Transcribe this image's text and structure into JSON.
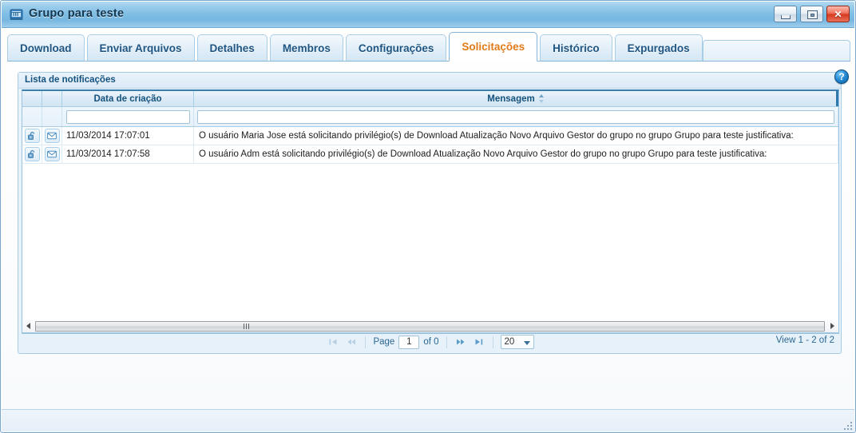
{
  "window": {
    "title": "Grupo para teste",
    "icon": "window-app-icon",
    "controls": [
      {
        "name": "minimize-button",
        "glyph": "minimize"
      },
      {
        "name": "maximize-button",
        "glyph": "maximize"
      },
      {
        "name": "close-button",
        "glyph": "✕"
      }
    ],
    "accent": "#7fbde4",
    "active_tab_color": "#e07b1a",
    "header_text_color": "#15527e"
  },
  "tabs": [
    {
      "label": "Download",
      "active": false
    },
    {
      "label": "Enviar Arquivos",
      "active": false
    },
    {
      "label": "Detalhes",
      "active": false
    },
    {
      "label": "Membros",
      "active": false
    },
    {
      "label": "Configurações",
      "active": false
    },
    {
      "label": "Solicitações",
      "active": true
    },
    {
      "label": "Histórico",
      "active": false
    },
    {
      "label": "Expurgados",
      "active": false
    }
  ],
  "panel": {
    "title": "Lista de notificações",
    "help_icon": "help-question-icon",
    "help_label": "?"
  },
  "grid": {
    "columns": [
      {
        "key": "action1",
        "label": "",
        "sortable": false
      },
      {
        "key": "action2",
        "label": "",
        "sortable": false
      },
      {
        "key": "date",
        "label": "Data de criação",
        "sortable": false
      },
      {
        "key": "message",
        "label": "Mensagem",
        "sortable": true,
        "sort_indicator": "sort-both-icon"
      }
    ],
    "filters": {
      "date_value": "",
      "date_placeholder": "",
      "message_value": "",
      "message_placeholder": ""
    },
    "rows": [
      {
        "action1_icon": "unlock-icon",
        "action2_icon": "envelope-icon",
        "date": "11/03/2014 17:07:01",
        "message": "O usuário Maria Jose está solicitando privilégio(s) de Download Atualização Novo Arquivo Gestor do grupo  no grupo Grupo para teste justificativa:"
      },
      {
        "action1_icon": "unlock-icon",
        "action2_icon": "envelope-icon",
        "date": "11/03/2014 17:07:58",
        "message": "O usuário Adm está solicitando privilégio(s) de Download Atualização Novo Arquivo Gestor do grupo  no grupo Grupo para teste justificativa:"
      }
    ]
  },
  "hscroll": {
    "left_arrow": "scroll-left-arrow-icon",
    "right_arrow": "scroll-right-arrow-icon",
    "grip": "scroll-grip-icon"
  },
  "pager": {
    "first_icon": "page-first-icon",
    "prev_icon": "page-prev-icon",
    "next_icon": "page-next-icon",
    "last_icon": "page-last-icon",
    "page_label": "Page",
    "page_value": "1",
    "of_label": "of 0",
    "page_size": "20",
    "page_size_options": [
      "20"
    ],
    "view_text": "View 1 - 2 of 2"
  },
  "footer": {
    "resize_grip": "resize-grip-icon"
  }
}
